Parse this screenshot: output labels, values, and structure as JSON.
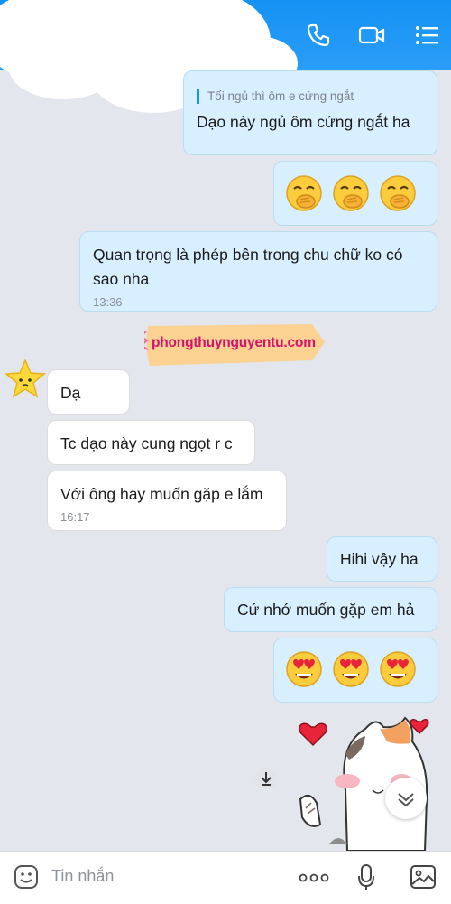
{
  "messages": {
    "quote_text": "Tối ngủ thì ôm e cứng ngắt",
    "m1": "Dạo này ngủ ôm cứng ngắt ha",
    "m3": "Quan trọng là phép bên trong chu chữ ko có sao nha",
    "m3_time": "13:36",
    "in1": "Dạ",
    "in2": "Tc dạo này cung ngọt r c",
    "in3": "Với ông hay muốn gặp e lắm",
    "in3_time": "16:17",
    "out4": "Hihi vậy ha",
    "out5": "Cứ nhớ muốn gặp em hả"
  },
  "watermark": "phongthuynguyentu.com",
  "input": {
    "placeholder": "Tin nhắn"
  },
  "icons": {
    "header": [
      "phone-icon",
      "video-call-icon",
      "menu-list-icon"
    ],
    "bottom": [
      "emoji-sticker-icon",
      "more-dots-icon",
      "microphone-icon",
      "image-gallery-icon"
    ]
  },
  "colors": {
    "header": "#1592f5",
    "outgoing_bubble": "#d7efff",
    "incoming_bubble": "#ffffff",
    "background": "#e3e6ec"
  }
}
